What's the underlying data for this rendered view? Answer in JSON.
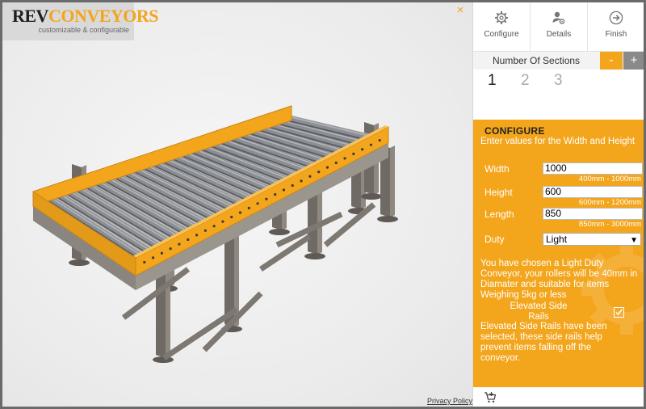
{
  "brand": {
    "title_part1": "REV",
    "title_part2": "CONVEYORS",
    "tagline": "customizable & configurable"
  },
  "viewer": {
    "close_symbol": "×",
    "privacy_link": "Privacy Policy"
  },
  "nav": [
    {
      "label": "Configure",
      "icon": "gear-icon"
    },
    {
      "label": "Details",
      "icon": "user-gear-icon"
    },
    {
      "label": "Finish",
      "icon": "arrow-circle-right-icon"
    }
  ],
  "sections": {
    "label": "Number Of Sections",
    "minus": "-",
    "plus": "+",
    "tabs": [
      "1",
      "2",
      "3"
    ],
    "active_index": 0
  },
  "configure": {
    "title": "CONFIGURE",
    "instructions": "Enter values for the Width and Height",
    "width": {
      "label": "Width",
      "value": "1000",
      "range": "400mm - 1000mm"
    },
    "height": {
      "label": "Height",
      "value": "600",
      "range": "600mm - 1200mm"
    },
    "length": {
      "label": "Length",
      "value": "850",
      "range": "850mm - 3000mm"
    },
    "duty": {
      "label": "Duty",
      "value": "Light"
    },
    "duty_message": "You have chosen a Light Duty Conveyor, your rollers will be 40mm in Diamater and suitable for items Weighing 5kg or less",
    "rails": {
      "label": "Elevated Side Rails",
      "checked": true,
      "check_symbol": "✓"
    },
    "rails_message": "Elevated Side Rails have been selected, these side rails help prevent items falling off the conveyor."
  },
  "colors": {
    "accent": "#f3a51c",
    "frame": "#6a6a6a",
    "steel": "#7d7871",
    "roller": "#8b8f95"
  }
}
